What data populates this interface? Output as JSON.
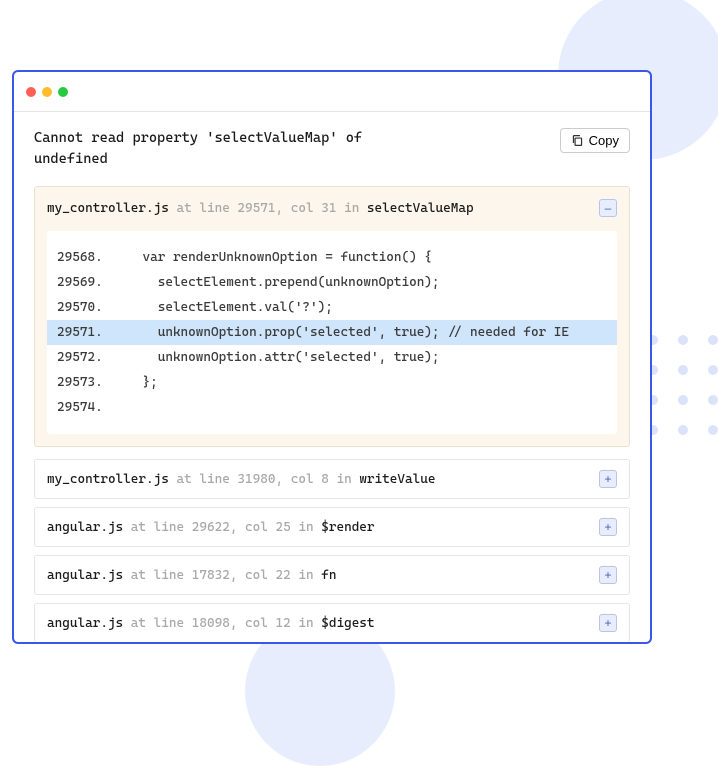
{
  "error_message": "Cannot read property 'selectValueMap' of undefined",
  "copy_label": "Copy",
  "frames": [
    {
      "file": "my_controller.js",
      "location": " at line 29571, col 31 in ",
      "fn": "selectValueMap",
      "expanded": true,
      "toggle": "–",
      "code": [
        {
          "n": "29568.",
          "t": "    var renderUnknownOption = function() {"
        },
        {
          "n": "29569.",
          "t": "      selectElement.prepend(unknownOption);"
        },
        {
          "n": "29570.",
          "t": "      selectElement.val('?');"
        },
        {
          "n": "29571.",
          "t": "      unknownOption.prop('selected', true); // needed for IE",
          "hl": true
        },
        {
          "n": "29572.",
          "t": "      unknownOption.attr('selected', true);"
        },
        {
          "n": "29573.",
          "t": "    };"
        },
        {
          "n": "29574.",
          "t": ""
        }
      ]
    },
    {
      "file": "my_controller.js",
      "location": " at line 31980, col 8 in ",
      "fn": "writeValue",
      "toggle": "+"
    },
    {
      "file": "angular.js",
      "location": " at line 29622, col 25 in ",
      "fn": "$render",
      "toggle": "+"
    },
    {
      "file": "angular.js",
      "location": " at line 17832, col 22 in ",
      "fn": "fn",
      "toggle": "+"
    },
    {
      "file": "angular.js",
      "location": " at line 18098, col 12 in ",
      "fn": "$digest",
      "toggle": "+"
    }
  ]
}
